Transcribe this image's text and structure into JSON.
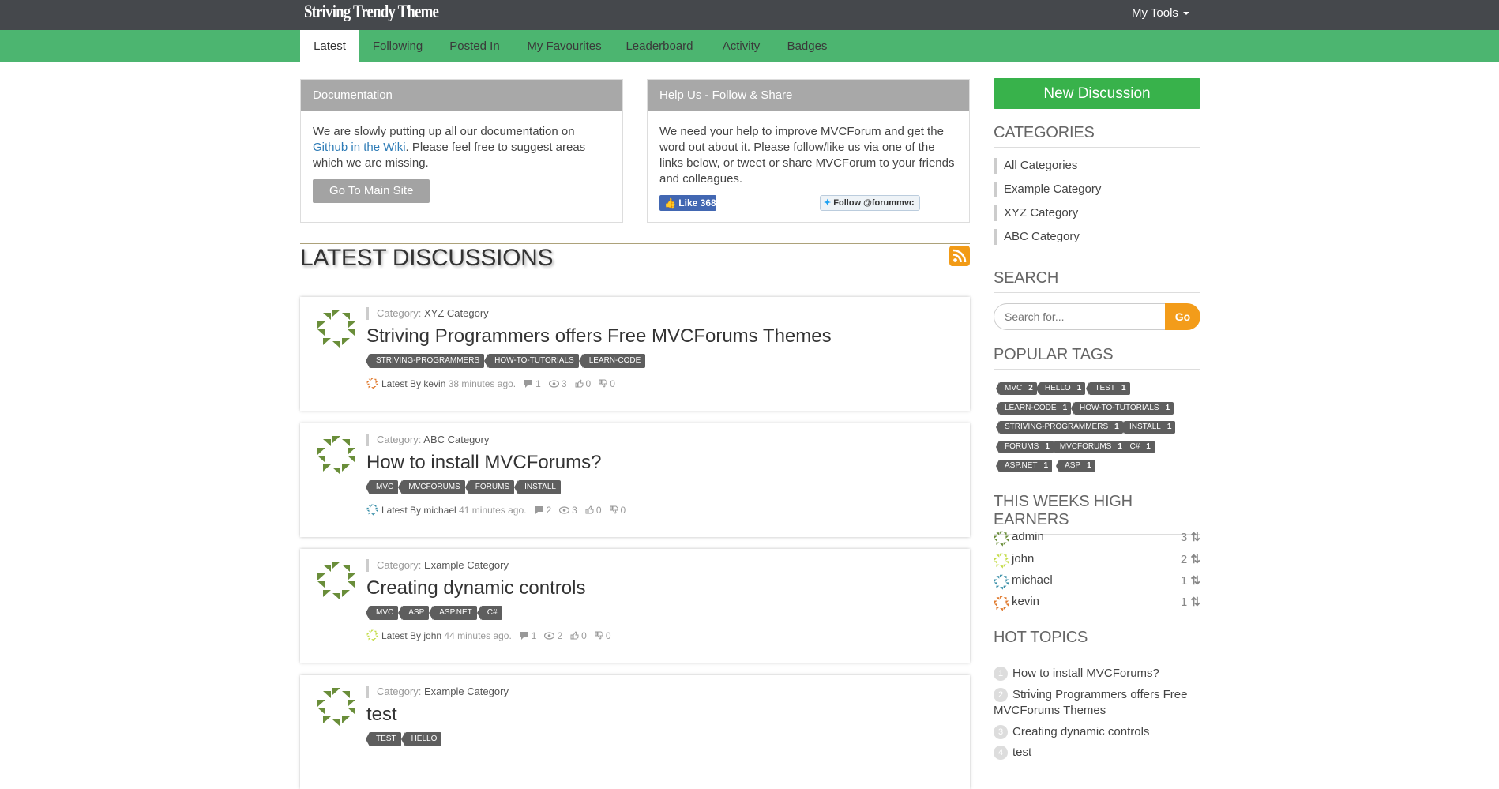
{
  "header": {
    "logo": "Striving Trendy Theme",
    "tools_label": "My Tools"
  },
  "nav": {
    "tabs": [
      {
        "label": "Latest",
        "active": true
      },
      {
        "label": "Following"
      },
      {
        "label": "Posted In"
      },
      {
        "label": "My Favourites"
      },
      {
        "label": "Leaderboard"
      },
      {
        "label": "Activity"
      },
      {
        "label": "Badges"
      }
    ]
  },
  "documentation": {
    "title": "Documentation",
    "text_before": "We are slowly putting up all our documentation on ",
    "link": "Github in the Wiki",
    "text_after": ". Please feel free to suggest areas which we are missing.",
    "button": "Go To Main Site"
  },
  "help": {
    "title": "Help Us - Follow & Share",
    "text": "We need your help to improve MVCForum and get the word out about it. Please follow/like us via one of the links below, or tweet or share MVCForum to your friends and colleagues.",
    "fb_label": "Like 368",
    "twitter_label": "Follow @forummvc"
  },
  "latest": {
    "heading": "LATEST DISCUSSIONS",
    "category_prefix": "Category:",
    "latest_by_prefix": "Latest By",
    "discussions": [
      {
        "category": "XYZ Category",
        "title": "Striving Programmers offers Free MVCForums Themes",
        "tags": [
          "STRIVING-PROGRAMMERS",
          "HOW-TO-TUTORIALS",
          "LEARN-CODE"
        ],
        "author": "kevin",
        "time": "38 minutes ago.",
        "comments": "1",
        "views": "3",
        "up": "0",
        "down": "0",
        "avatar_color": "#e07a2e"
      },
      {
        "category": "ABC Category",
        "title": "How to install MVCForums?",
        "tags": [
          "MVC",
          "MVCFORUMS",
          "FORUMS",
          "INSTALL"
        ],
        "author": "michael",
        "time": "41 minutes ago.",
        "comments": "2",
        "views": "3",
        "up": "0",
        "down": "0",
        "avatar_color": "#3a8fa8"
      },
      {
        "category": "Example Category",
        "title": "Creating dynamic controls",
        "tags": [
          "MVC",
          "ASP",
          "ASP.NET",
          "C#"
        ],
        "author": "john",
        "time": "44 minutes ago.",
        "comments": "1",
        "views": "2",
        "up": "0",
        "down": "0",
        "avatar_color": "#c4dc4a"
      },
      {
        "category": "Example Category",
        "title": "test",
        "tags": [
          "TEST",
          "HELLO"
        ],
        "author": "",
        "time": "",
        "comments": "",
        "views": "",
        "up": "",
        "down": "",
        "avatar_color": "#6a8e3a"
      }
    ]
  },
  "sidebar": {
    "new_discussion": "New Discussion",
    "categories_heading": "CATEGORIES",
    "categories": [
      "All Categories",
      "Example Category",
      "XYZ Category",
      "ABC Category"
    ],
    "search_heading": "SEARCH",
    "search_placeholder": "Search for...",
    "search_button": "Go",
    "tags_heading": "POPULAR TAGS",
    "popular_tags": [
      {
        "name": "MVC",
        "count": "2"
      },
      {
        "name": "HELLO",
        "count": "1"
      },
      {
        "name": "TEST",
        "count": "1"
      },
      {
        "name": "LEARN-CODE",
        "count": "1"
      },
      {
        "name": "HOW-TO-TUTORIALS",
        "count": "1"
      },
      {
        "name": "STRIVING-PROGRAMMERS",
        "count": "1"
      },
      {
        "name": "INSTALL",
        "count": "1"
      },
      {
        "name": "FORUMS",
        "count": "1"
      },
      {
        "name": "MVCFORUMS",
        "count": "1"
      },
      {
        "name": "C#",
        "count": "1"
      },
      {
        "name": "ASP.NET",
        "count": "1"
      },
      {
        "name": "ASP",
        "count": "1"
      }
    ],
    "earners_heading": "THIS WEEKS HIGH EARNERS",
    "earners": [
      {
        "name": "admin",
        "points": "3",
        "color": "#6a8e3a"
      },
      {
        "name": "john",
        "points": "2",
        "color": "#c4dc4a"
      },
      {
        "name": "michael",
        "points": "1",
        "color": "#3a8fa8"
      },
      {
        "name": "kevin",
        "points": "1",
        "color": "#e07a2e"
      }
    ],
    "hot_heading": "HOT TOPICS",
    "hot_topics": [
      {
        "num": "1",
        "title": "How to install MVCForums?"
      },
      {
        "num": "2",
        "title": "Striving Programmers offers Free MVCForums Themes"
      },
      {
        "num": "3",
        "title": "Creating dynamic controls"
      },
      {
        "num": "4",
        "title": "test"
      }
    ]
  },
  "colors": {
    "topbar": "#45484c",
    "nav_green": "#4cb570",
    "accent_green": "#38b24b",
    "orange": "#f39c1a",
    "tag_gray": "#5e5e5e"
  }
}
